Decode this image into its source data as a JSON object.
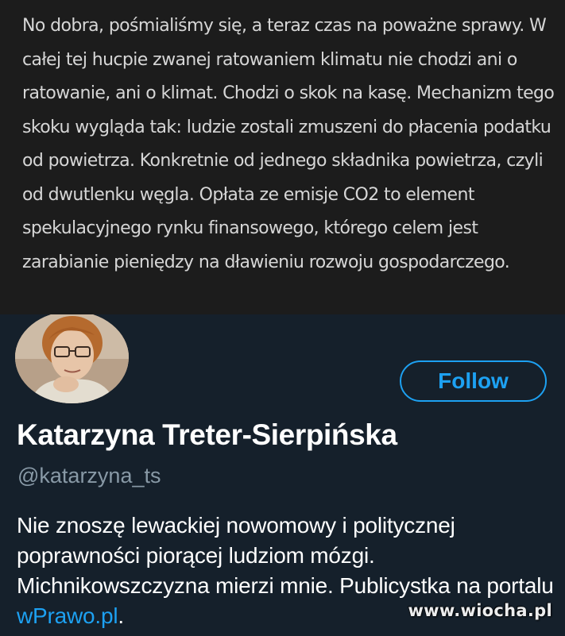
{
  "top_post": {
    "text": "No dobra, pośmialiśmy się, a teraz czas na poważne sprawy. W całej tej hucpie zwanej ratowaniem klimatu nie chodzi ani o ratowanie, ani o klimat. Chodzi o skok na kasę. Mechanizm tego skoku wygląda tak: ludzie zostali zmuszeni do płacenia podatku od powietrza. Konkretnie od jednego składnika powietrza, czyli od dwutlenku węgla. Opłata ze emisje CO2 to element spekulacyjnego rynku finansowego, którego celem jest zarabianie pieniędzy na dławieniu rozwoju gospodarczego."
  },
  "profile": {
    "display_name": "Katarzyna Treter-Sierpińska",
    "handle": "@katarzyna_ts",
    "follow_label": "Follow",
    "bio_text": "Nie znoszę lewackiej nowomowy i politycznej poprawności piorącej ludziom mózgi. Michnikowszczyzna mierzi mnie. Publicystka na portalu ",
    "bio_link": "wPrawo.pl",
    "bio_suffix": "."
  },
  "watermark": "www.wiocha.pl",
  "colors": {
    "post_background": "#1c1c1c",
    "post_text": "#d6d6d6",
    "card_background": "#15202b",
    "accent": "#1da1f2",
    "secondary_text": "#8899a6"
  }
}
